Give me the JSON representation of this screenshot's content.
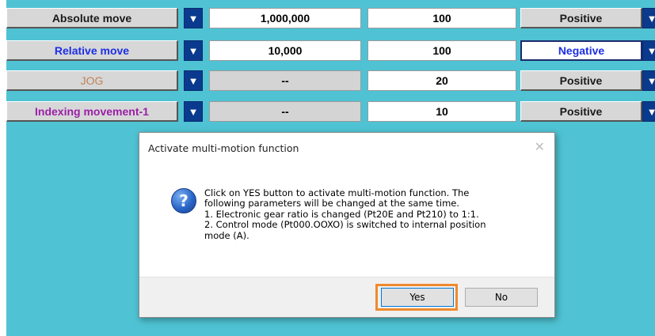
{
  "rows": [
    {
      "mode": "Absolute move",
      "mode_color": "#1a1a1a",
      "value": "1,000,000",
      "speed": "100",
      "direction": "Positive",
      "direction_color": "#1a1a1a",
      "value_grey": false,
      "direction_white": false
    },
    {
      "mode": "Relative move",
      "mode_color": "#1d2ee6",
      "value": "10,000",
      "speed": "100",
      "direction": "Negative",
      "direction_color": "#1d2ee6",
      "value_grey": false,
      "direction_white": true
    },
    {
      "mode": "JOG",
      "mode_color": "#c0835a",
      "value": "--",
      "speed": "20",
      "direction": "Positive",
      "direction_color": "#1a1a1a",
      "value_grey": true,
      "direction_white": false
    },
    {
      "mode": "Indexing movement-1",
      "mode_color": "#9a1fa6",
      "value": "--",
      "speed": "10",
      "direction": "Positive",
      "direction_color": "#1a1a1a",
      "value_grey": true,
      "direction_white": false
    }
  ],
  "dropdown_glyph": "▼",
  "dialog": {
    "title": "Activate multi-motion function",
    "close": "✕",
    "icon": "question-icon",
    "icon_glyph": "?",
    "lines": [
      "Click on YES button to activate multi-motion function. The",
      "following parameters will be changed at the same time.",
      "1. Electronic gear ratio is changed (Pt20E and Pt210) to 1:1.",
      "2. Control mode (Pt000.OOXO) is switched to internal position",
      "mode (A)."
    ],
    "yes_label": "Yes",
    "no_label": "No",
    "highlight_color": "#ef8a2e"
  },
  "colors": {
    "background": "#4fc3d3",
    "dropdown": "#0a3a8e"
  }
}
